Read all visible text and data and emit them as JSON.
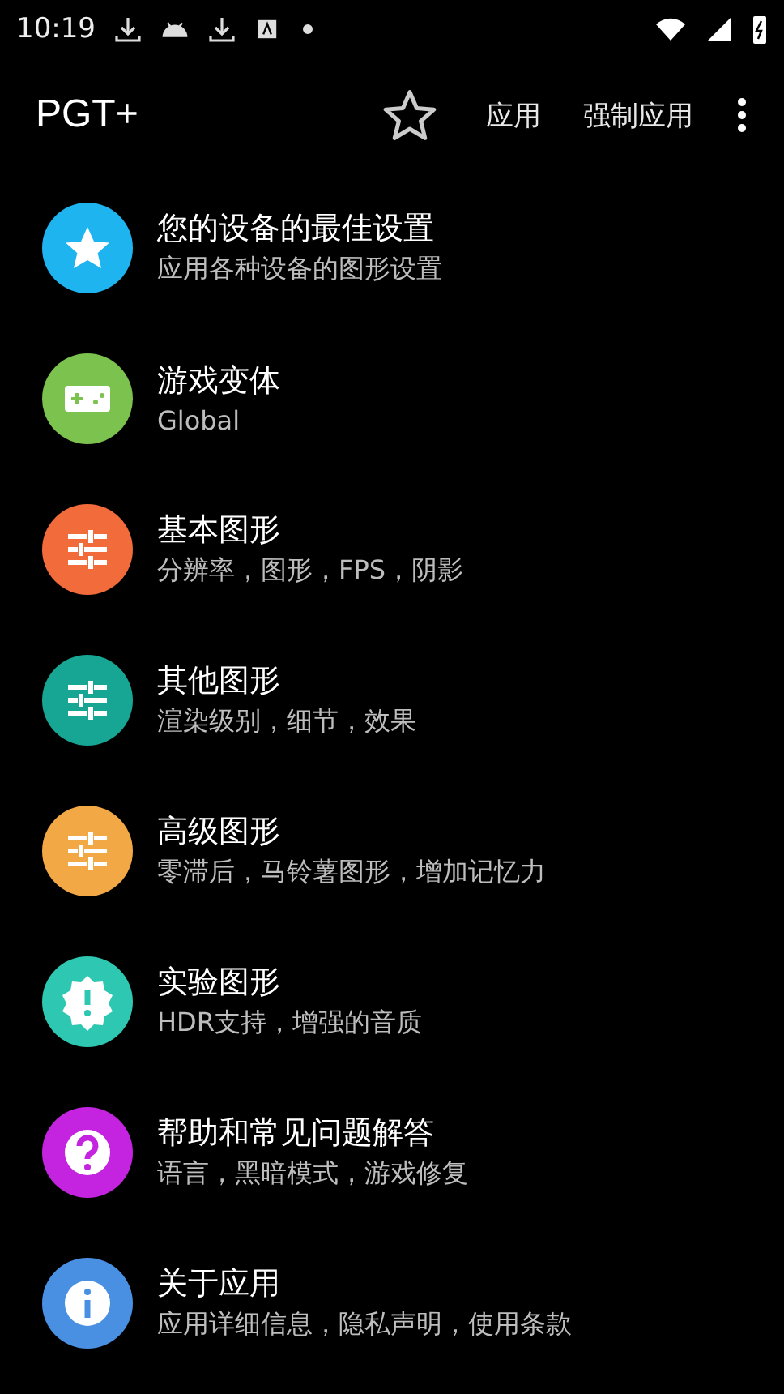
{
  "status_bar": {
    "time": "10:19"
  },
  "app_bar": {
    "title": "PGT+",
    "actions": [
      "应用",
      "强制应用"
    ]
  },
  "items": [
    {
      "title": "您的设备的最佳设置",
      "subtitle": "应用各种设备的图形设置",
      "kind": "star",
      "color": "#1eb4f0"
    },
    {
      "title": "游戏变体",
      "subtitle": "Global",
      "kind": "gamepad",
      "color": "#7cc24e"
    },
    {
      "title": "基本图形",
      "subtitle": "分辨率，图形，FPS，阴影",
      "kind": "sliders",
      "color": "#f26b3a"
    },
    {
      "title": "其他图形",
      "subtitle": "渲染级别，细节，效果",
      "kind": "sliders",
      "color": "#17a594"
    },
    {
      "title": "高级图形",
      "subtitle": "零滞后，马铃薯图形，增加记忆力",
      "kind": "sliders",
      "color": "#f2a845"
    },
    {
      "title": "实验图形",
      "subtitle": "HDR支持，增强的音质",
      "kind": "seal",
      "color": "#2ec7b1"
    },
    {
      "title": "帮助和常见问题解答",
      "subtitle": "语言，黑暗模式，游戏修复",
      "kind": "question",
      "color": "#c424e0"
    },
    {
      "title": "关于应用",
      "subtitle": "应用详细信息，隐私声明，使用条款",
      "kind": "info",
      "color": "#4a90e2"
    }
  ]
}
